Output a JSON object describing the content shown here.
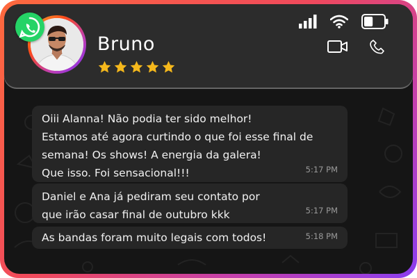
{
  "contact": {
    "name": "Bruno",
    "rating": 5
  },
  "messages": [
    {
      "text": "Oiii Alanna! Não podia ter sido melhor!\nEstamos até agora curtindo o que foi esse final de\nsemana! Os shows! A energia da galera!\nQue isso. Foi sensacional!!!",
      "time": "5:17 PM"
    },
    {
      "text": "Daniel e Ana já pediram seu contato por\nque irão casar final de outubro kkk",
      "time": "5:17 PM"
    },
    {
      "text": "As bandas foram muito legais com todos!",
      "time": "5:18 PM"
    }
  ],
  "icons": {
    "app": "whatsapp-icon",
    "signal": "signal-icon",
    "wifi": "wifi-icon",
    "battery": "battery-icon",
    "video": "video-camera-icon",
    "call": "phone-icon",
    "star": "star-icon"
  },
  "colors": {
    "frame_gradient": [
      "#ff6a3d",
      "#f0495c",
      "#c23fb0",
      "#8a3df0"
    ],
    "whatsapp": "#25d366",
    "star": "#f5b81c",
    "bubble": "#262626",
    "header": "#2c2c2c"
  },
  "battery_level": 0.45
}
